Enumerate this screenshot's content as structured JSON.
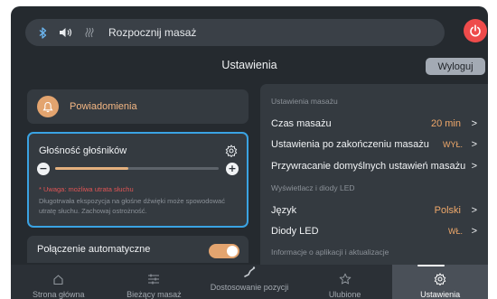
{
  "topbar": {
    "icons": [
      "bluetooth-icon",
      "speaker-icon",
      "heat-icon"
    ],
    "title": "Rozpocznij masaż"
  },
  "header": {
    "title": "Ustawienia",
    "logout_label": "Wyloguj"
  },
  "left": {
    "notifications_label": "Powiadomienia",
    "volume": {
      "title": "Głośność głośników",
      "minus": "−",
      "plus": "+",
      "level": 0.45,
      "warning": "* Uwaga: możliwa utrata słuchu",
      "description": "Długotrwała ekspozycja na głośne dźwięki może spowodować utratę słuchu. Zachowaj ostrożność."
    },
    "auto_connect": {
      "label": "Połączenie automatyczne",
      "enabled": true
    }
  },
  "right": {
    "section_massage": "Ustawienia masażu",
    "massage_time_label": "Czas masażu",
    "massage_time_value": "20 min",
    "after_massage_label": "Ustawienia po zakończeniu masażu",
    "after_massage_value": "WYŁ.",
    "restore_defaults_label": "Przywracanie domyślnych ustawień masażu",
    "section_display": "Wyświetlacz i diody LED",
    "language_label": "Język",
    "language_value": "Polski",
    "led_label": "Diody LED",
    "led_value": "WŁ.",
    "section_info": "Informacje o aplikacji i aktualizacje",
    "chevron": ">"
  },
  "nav": {
    "items": [
      {
        "label": "Strona główna",
        "icon": "home-icon"
      },
      {
        "label": "Bieżący masaż",
        "icon": "sliders-icon"
      },
      {
        "label": "Dostosowanie pozycji",
        "icon": "recline-icon"
      },
      {
        "label": "Ulubione",
        "icon": "star-icon"
      },
      {
        "label": "Ustawienia",
        "icon": "gear-icon"
      }
    ],
    "active_index": 4
  },
  "colors": {
    "accent": "#efa86a",
    "focus": "#3aa3e3",
    "power": "#ee4b4b",
    "warning": "#e05555"
  }
}
